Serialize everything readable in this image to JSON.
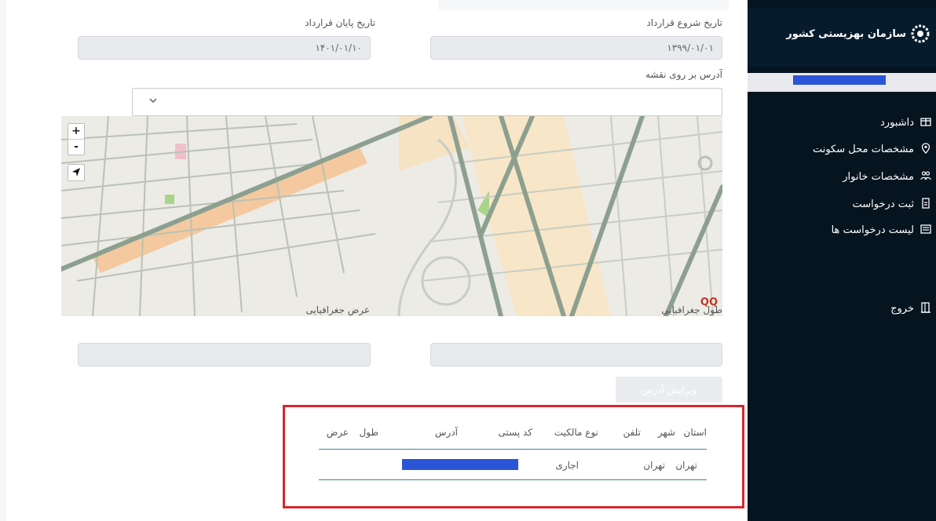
{
  "app": {
    "title": "سازمان بهزیستی کشور"
  },
  "sidebar": {
    "items": [
      {
        "label": "داشبورد",
        "icon": "dashboard-icon"
      },
      {
        "label": "مشخصات محل سکونت",
        "icon": "location-pin-icon"
      },
      {
        "label": "مشخصات خانوار",
        "icon": "users-icon"
      },
      {
        "label": "ثبت درخواست",
        "icon": "document-icon"
      },
      {
        "label": "لیست درخواست ها",
        "icon": "inbox-list-icon"
      }
    ],
    "logout": {
      "label": "خروج",
      "icon": "exit-door-icon"
    }
  },
  "form": {
    "contract_start": {
      "label": "تاریخ شروع قرارداد",
      "value": "۱۳۹۹/۰۱/۰۱"
    },
    "contract_end": {
      "label": "تاریخ پایان قرارداد",
      "value": "۱۴۰۱/۰۱/۱۰"
    },
    "map_address": {
      "label": "آدرس بر روی نقشه",
      "value": ""
    },
    "longitude": {
      "label": "طول جغرافیایی",
      "value": ""
    },
    "latitude": {
      "label": "عرض جغرافیایی",
      "value": ""
    },
    "edit_address_label": "ویرایش آدرس"
  },
  "map": {
    "zoom_in": "+",
    "zoom_out": "-",
    "brand": "QQ"
  },
  "table": {
    "headers": [
      "استان",
      "شهر",
      "تلفن",
      "نوع مالکیت",
      "کد پستی",
      "آدرس",
      "طول",
      "عرض"
    ],
    "rows": [
      {
        "province": "تهران",
        "city": "تهران",
        "phone": "",
        "ownership": "اجاری",
        "postal_code": "",
        "address": "",
        "lon": "",
        "lat": ""
      }
    ]
  },
  "colors": {
    "sidebar_bg": "#05141f",
    "highlight": "#d9262c",
    "redaction": "#2a55d6",
    "table_rule": "#2c8f8f"
  }
}
